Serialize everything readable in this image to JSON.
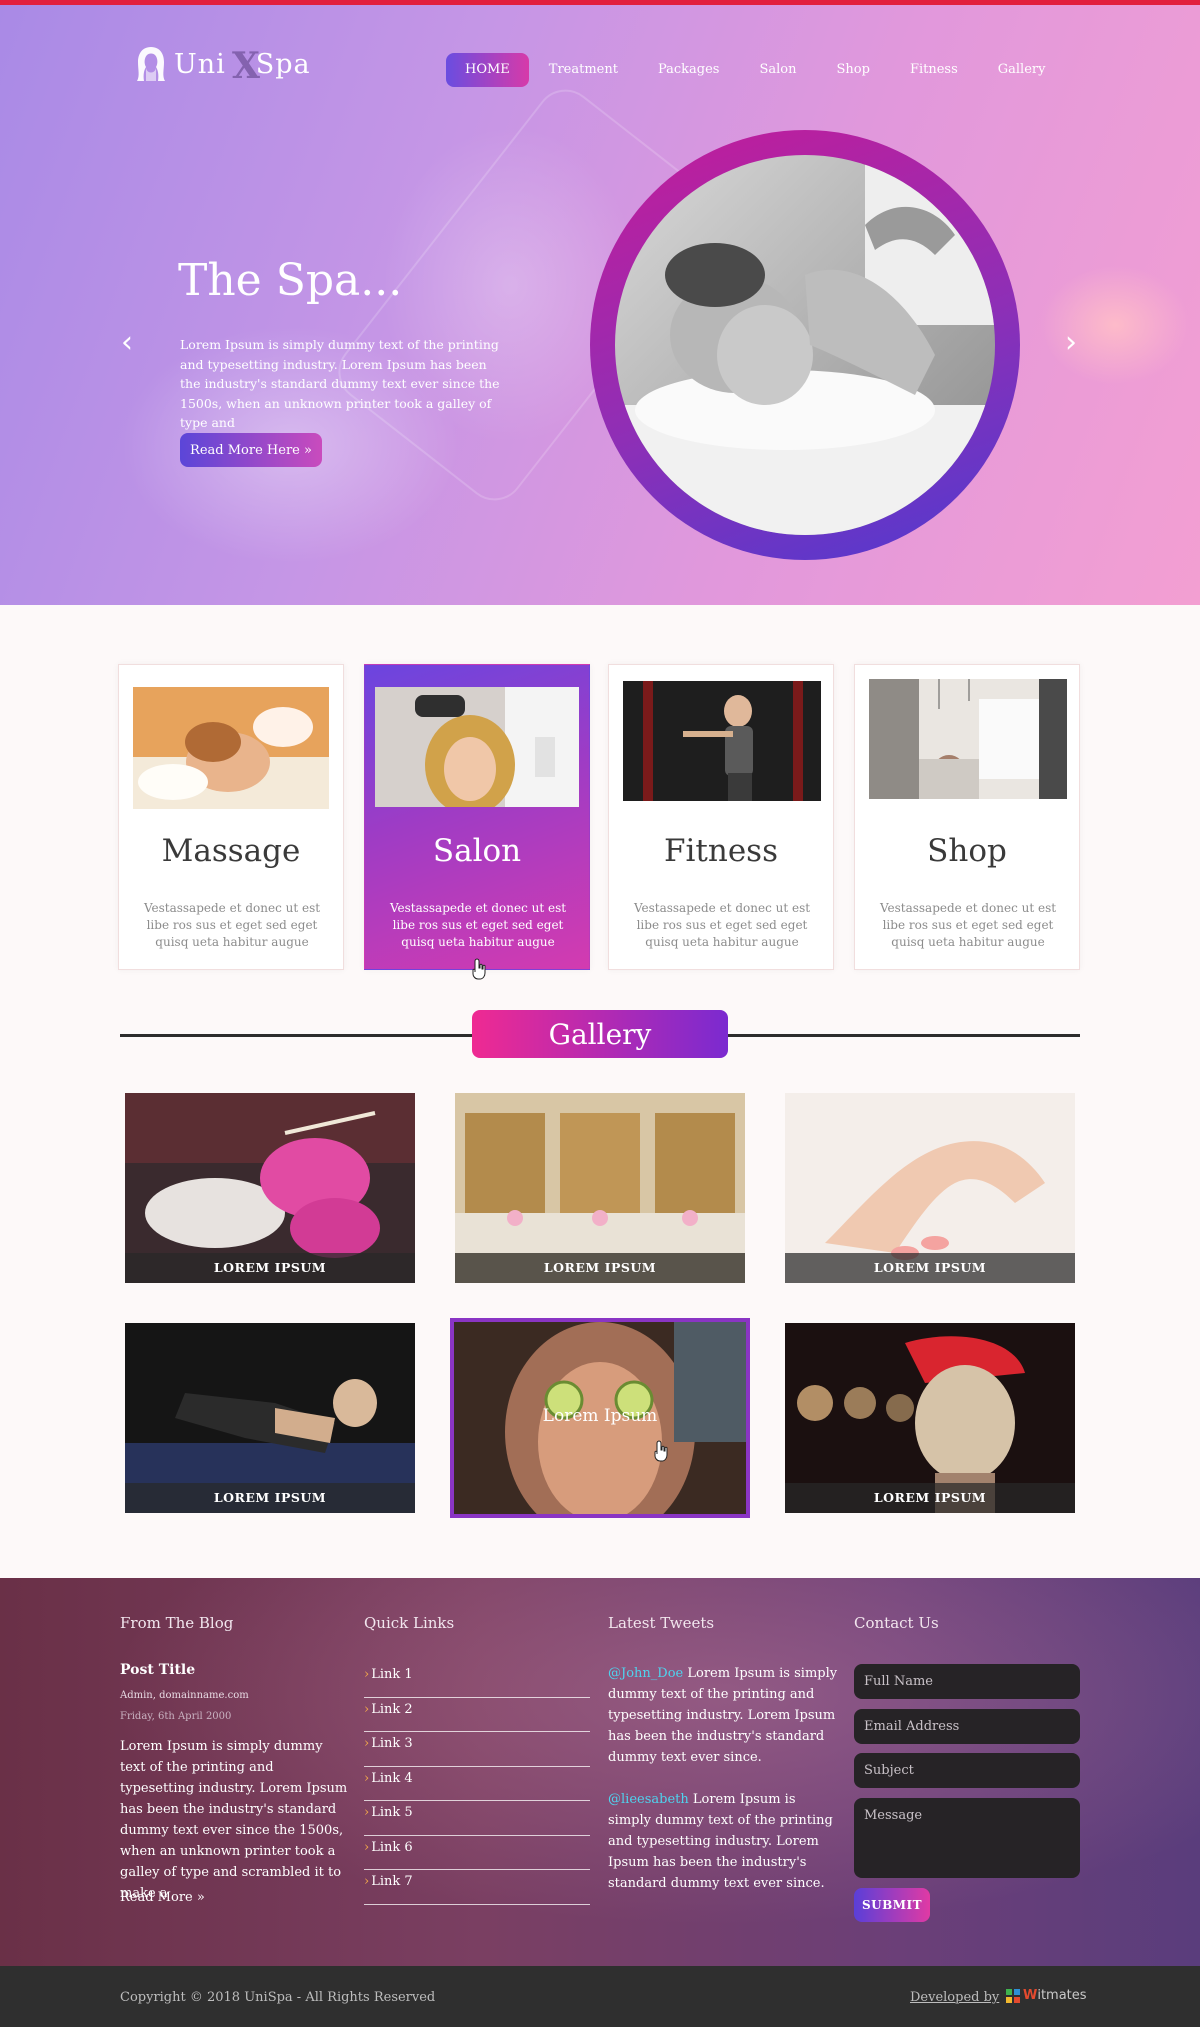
{
  "brand": {
    "name_left": "Uni",
    "name_x": "X",
    "name_right": "Spa",
    "accent": "#e21f3e"
  },
  "nav": {
    "items": [
      "HOME",
      "Treatment",
      "Packages",
      "Salon",
      "Shop",
      "Fitness",
      "Gallery"
    ],
    "active": "HOME"
  },
  "hero": {
    "title": "The Spa...",
    "text": "Lorem Ipsum is simply dummy text of the printing and typesetting industry. Lorem Ipsum has been the industry's standard dummy text ever since the 1500s, when an unknown printer took a galley of type and",
    "button": "Read More Here »",
    "prev_icon": "chevron-left-icon",
    "next_icon": "chevron-right-icon"
  },
  "services": [
    {
      "title": "Massage",
      "desc": "Vestassapede et donec ut est libe ros sus et eget sed eget quisq ueta habitur augue"
    },
    {
      "title": "Salon",
      "desc": "Vestassapede et donec ut est libe ros sus et eget sed eget quisq ueta habitur augue"
    },
    {
      "title": "Fitness",
      "desc": "Vestassapede et donec ut est libe ros sus et eget sed eget quisq ueta habitur augue"
    },
    {
      "title": "Shop",
      "desc": "Vestassapede et donec ut est libe ros sus et eget sed eget quisq ueta habitur augue"
    }
  ],
  "gallery": {
    "title": "Gallery",
    "items": [
      {
        "caption": "LOREM IPSUM"
      },
      {
        "caption": "LOREM IPSUM"
      },
      {
        "caption": "LOREM IPSUM"
      },
      {
        "caption": "LOREM IPSUM"
      },
      {
        "caption": "Lorem Ipsum"
      },
      {
        "caption": "LOREM IPSUM"
      }
    ]
  },
  "footer": {
    "blog": {
      "heading": "From The Blog",
      "post_title": "Post Title",
      "meta": "Admin, domainname.com",
      "date": "Friday, 6th April 2000",
      "body": "Lorem Ipsum is simply dummy text of the printing and typesetting industry. Lorem Ipsum has been the industry's standard dummy text ever since the 1500s, when an unknown printer took a galley of type and scrambled it to make a",
      "read_more": "Read More »"
    },
    "links": {
      "heading": "Quick Links",
      "items": [
        "Link 1",
        "Link 2",
        "Link 3",
        "Link 4",
        "Link 5",
        "Link 6",
        "Link 7"
      ]
    },
    "tweets": {
      "heading": "Latest Tweets",
      "items": [
        {
          "handle": "@John_Doe",
          "text": " Lorem Ipsum is simply dummy text of the printing and typesetting industry. Lorem Ipsum has been the industry's standard dummy text ever since."
        },
        {
          "handle": "@lieesabeth",
          "text": " Lorem Ipsum is simply dummy text of the printing and typesetting industry. Lorem Ipsum has been the industry's standard dummy text ever since."
        }
      ]
    },
    "contact": {
      "heading": "Contact Us",
      "name_placeholder": "Full Name",
      "email_placeholder": "Email Address",
      "subject_placeholder": "Subject",
      "message_placeholder": "Message",
      "submit": "SUBMIT"
    }
  },
  "bottom": {
    "copyright": "Copyright © 2018 UniSpa - All Rights Reserved",
    "developed_by": "Developed by",
    "dev_brand_w": "W",
    "dev_brand_rest": "itmates"
  }
}
